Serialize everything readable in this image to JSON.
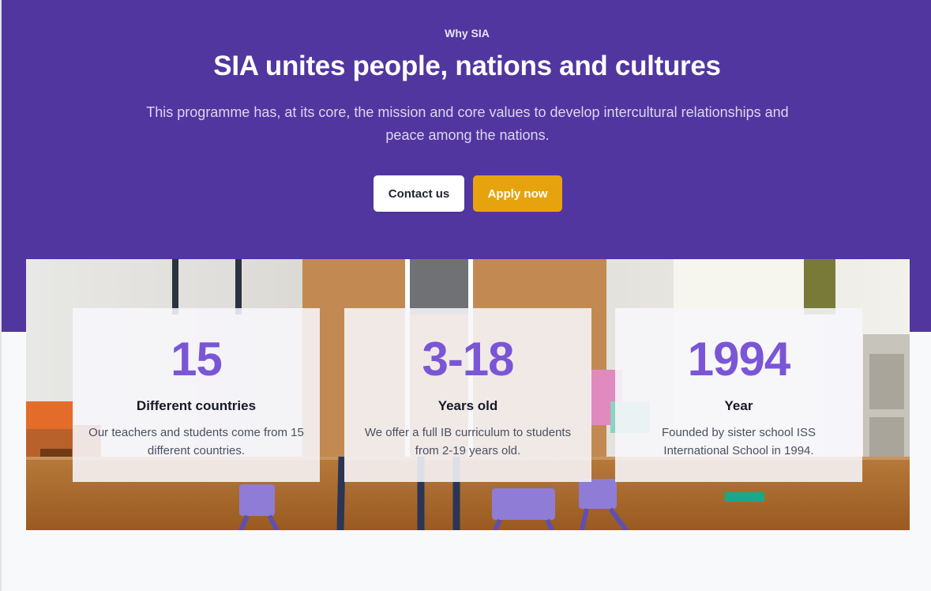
{
  "hero": {
    "eyebrow": "Why SIA",
    "headline": "SIA unites people, nations and cultures",
    "subtitle": "This programme has, at its core, the mission and core values to develop intercultural relationships and peace among the nations.",
    "contact_label": "Contact us",
    "apply_label": "Apply now"
  },
  "stats": [
    {
      "number": "15",
      "title": "Different countries",
      "description": "Our teachers and students come from 15 different countries."
    },
    {
      "number": "3-18",
      "title": "Years old",
      "description": "We offer a full IB curriculum to students from 2-19 years old."
    },
    {
      "number": "1994",
      "title": "Year",
      "description": "Founded by sister school ISS International School in 1994."
    }
  ],
  "colors": {
    "hero_background": "#5136a0",
    "accent_purple": "#7a56d6",
    "apply_button": "#e7a30e",
    "page_background": "#f8f9fb"
  },
  "image": {
    "subject": "classroom-photo"
  }
}
